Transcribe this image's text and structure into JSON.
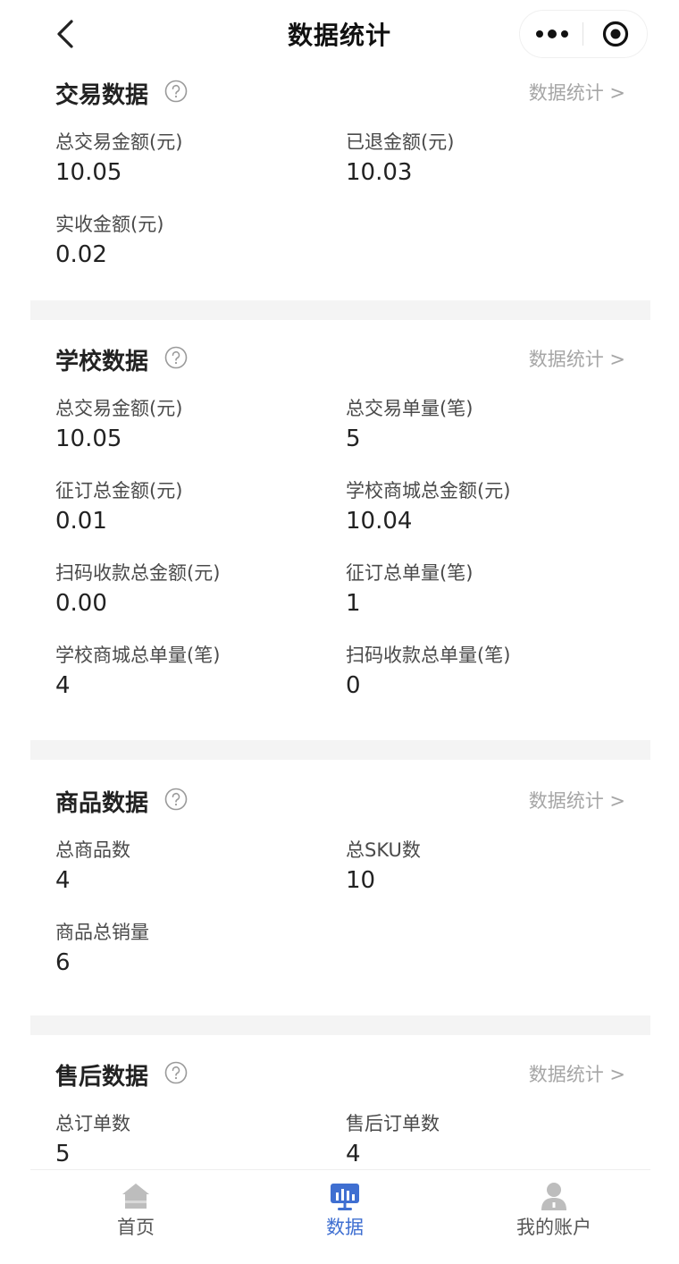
{
  "nav": {
    "title": "数据统计"
  },
  "sections": [
    {
      "title": "交易数据",
      "link": "数据统计 >",
      "items": [
        {
          "label": "总交易金额(元)",
          "value": "10.05"
        },
        {
          "label": "已退金额(元)",
          "value": "10.03"
        },
        {
          "label": "实收金额(元)",
          "value": "0.02"
        }
      ]
    },
    {
      "title": "学校数据",
      "link": "数据统计 >",
      "items": [
        {
          "label": "总交易金额(元)",
          "value": "10.05"
        },
        {
          "label": "总交易单量(笔)",
          "value": "5"
        },
        {
          "label": "征订总金额(元)",
          "value": "0.01"
        },
        {
          "label": "学校商城总金额(元)",
          "value": "10.04"
        },
        {
          "label": "扫码收款总金额(元)",
          "value": "0.00"
        },
        {
          "label": "征订总单量(笔)",
          "value": "1"
        },
        {
          "label": "学校商城总单量(笔)",
          "value": "4"
        },
        {
          "label": "扫码收款总单量(笔)",
          "value": "0"
        }
      ]
    },
    {
      "title": "商品数据",
      "link": "数据统计 >",
      "items": [
        {
          "label": "总商品数",
          "value": "4"
        },
        {
          "label": "总SKU数",
          "value": "10"
        },
        {
          "label": "商品总销量",
          "value": "6"
        }
      ]
    },
    {
      "title": "售后数据",
      "link": "数据统计 >",
      "items": [
        {
          "label": "总订单数",
          "value": "5"
        },
        {
          "label": "售后订单数",
          "value": "4"
        }
      ]
    }
  ],
  "tabbar": {
    "active_color": "#3f6fd1",
    "items": [
      {
        "label": "首页",
        "icon": "home-icon"
      },
      {
        "label": "数据",
        "icon": "data-chart-icon"
      },
      {
        "label": "我的账户",
        "icon": "user-icon"
      }
    ]
  }
}
